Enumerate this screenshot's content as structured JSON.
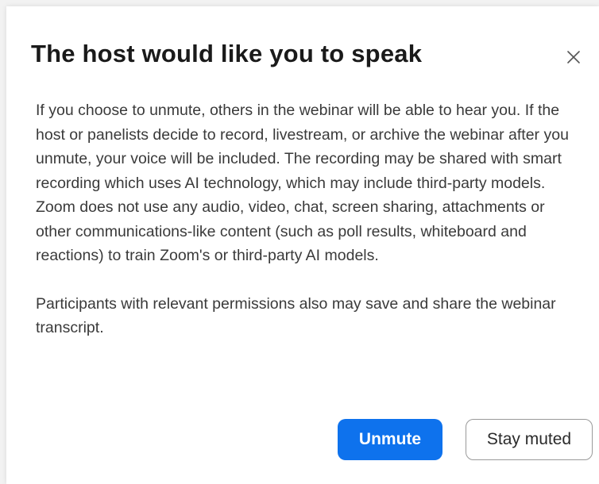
{
  "dialog": {
    "title": "The host would like you to speak",
    "close_icon": "close-icon",
    "paragraphs": [
      "If you choose to unmute, others in the webinar will be able to hear you. If the host or panelists decide to record, livestream, or archive the webinar after you unmute, your voice will be included. The recording may be shared with smart recording which uses AI technology, which may include third-party models. Zoom does not use any audio, video, chat, screen sharing, attachments or other communications-like content (such as poll results, whiteboard and reactions) to train Zoom's or third-party AI models.",
      "Participants with relevant permissions also may save and share the webinar transcript."
    ],
    "buttons": {
      "unmute_label": "Unmute",
      "stay_muted_label": "Stay muted"
    }
  },
  "colors": {
    "primary": "#0e72ed",
    "title_text": "#1a1a1a",
    "body_text": "#3a3a3a"
  }
}
